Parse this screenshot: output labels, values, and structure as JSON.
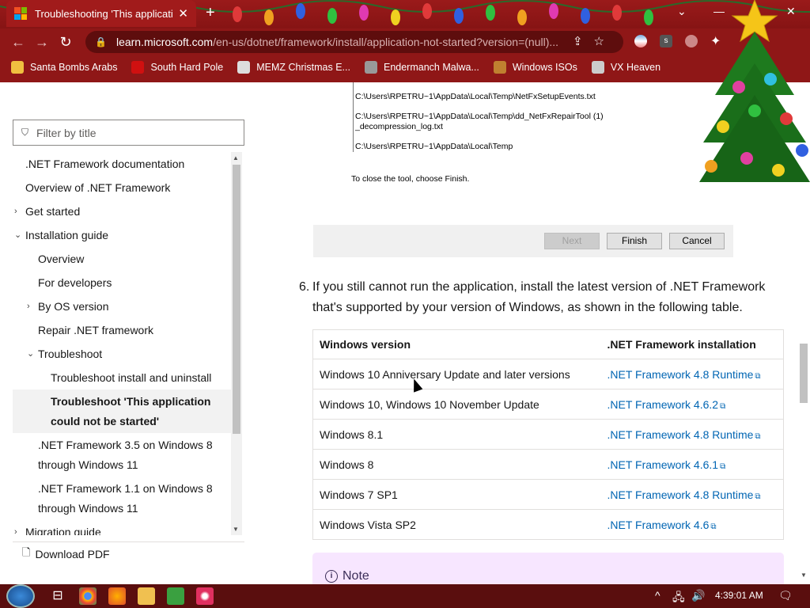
{
  "browser": {
    "tab_title": "Troubleshooting 'This application",
    "url_host": "learn.microsoft.com",
    "url_path": "/en-us/dotnet/framework/install/application-not-started?version=(null)...",
    "bookmarks": [
      {
        "label": "Santa Bombs Arabs",
        "color": "#f0c040"
      },
      {
        "label": "South Hard Pole",
        "color": "#d01010"
      },
      {
        "label": "MEMZ Christmas E...",
        "color": "#dddddd"
      },
      {
        "label": "Endermanch Malwa...",
        "color": "#999999"
      },
      {
        "label": "Windows ISOs",
        "color": "#c08030"
      },
      {
        "label": "VX Heaven",
        "color": "#cccccc"
      }
    ]
  },
  "sidebar": {
    "filter_placeholder": "Filter by title",
    "items": [
      {
        "label": ".NET Framework documentation",
        "indent": 0,
        "chevron": ""
      },
      {
        "label": "Overview of .NET Framework",
        "indent": 0,
        "chevron": ""
      },
      {
        "label": "Get started",
        "indent": 0,
        "chevron": "collapsed"
      },
      {
        "label": "Installation guide",
        "indent": 0,
        "chevron": "expanded"
      },
      {
        "label": "Overview",
        "indent": 1,
        "chevron": ""
      },
      {
        "label": "For developers",
        "indent": 1,
        "chevron": ""
      },
      {
        "label": "By OS version",
        "indent": 1,
        "chevron": "collapsed"
      },
      {
        "label": "Repair .NET framework",
        "indent": 1,
        "chevron": ""
      },
      {
        "label": "Troubleshoot",
        "indent": 1,
        "chevron": "expanded"
      },
      {
        "label": "Troubleshoot install and uninstall",
        "indent": 2,
        "chevron": ""
      },
      {
        "label": "Troubleshoot 'This application could not be started'",
        "indent": 2,
        "chevron": "",
        "selected": true
      },
      {
        "label": ".NET Framework 3.5 on Windows 8 through Windows 11",
        "indent": 1,
        "chevron": ""
      },
      {
        "label": ".NET Framework 1.1 on Windows 8 through Windows 11",
        "indent": 1,
        "chevron": ""
      },
      {
        "label": "Migration guide",
        "indent": 0,
        "chevron": "collapsed"
      }
    ],
    "download_pdf": "Download PDF"
  },
  "screenshot": {
    "log_lines": [
      "C:\\Users\\RPETRU~1\\AppData\\Local\\Temp\\NetFxSetupEvents.txt",
      "C:\\Users\\RPETRU~1\\AppData\\Local\\Temp\\dd_NetFxRepairTool (1)",
      "_decompression_log.txt",
      "C:\\Users\\RPETRU~1\\AppData\\Local\\Temp"
    ],
    "close_msg": "To close the tool, choose Finish.",
    "buttons": {
      "next": "Next",
      "finish": "Finish",
      "cancel": "Cancel"
    }
  },
  "main": {
    "step_number": "6.",
    "step_text": "If you still cannot run the application, install the latest version of .NET Framework that's supported by your version of Windows, as shown in the following table.",
    "table": {
      "headers": [
        "Windows version",
        ".NET Framework installation"
      ],
      "rows": [
        [
          "Windows 10 Anniversary Update and later versions",
          ".NET Framework 4.8 Runtime"
        ],
        [
          "Windows 10, Windows 10 November Update",
          ".NET Framework 4.6.2"
        ],
        [
          "Windows 8.1",
          ".NET Framework 4.8 Runtime"
        ],
        [
          "Windows 8",
          ".NET Framework 4.6.1"
        ],
        [
          "Windows 7 SP1",
          ".NET Framework 4.8 Runtime"
        ],
        [
          "Windows Vista SP2",
          ".NET Framework 4.6"
        ]
      ]
    },
    "note_label": "Note"
  },
  "taskbar": {
    "time": "4:39:01 AM"
  },
  "colors": {
    "link": "#0065b3",
    "chrome_bg": "#8f1717",
    "note_bg": "#f7e6ff"
  }
}
